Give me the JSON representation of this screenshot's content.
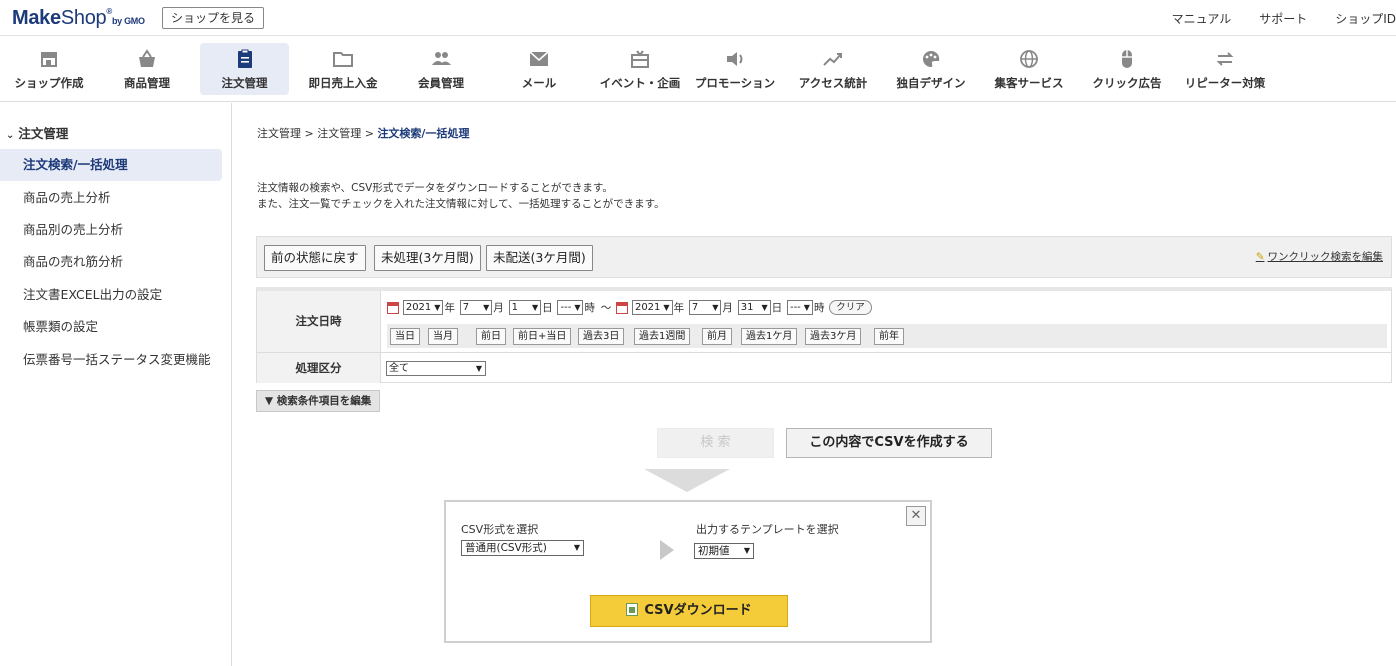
{
  "brand": {
    "name_bold": "Make",
    "name_rest": "Shop",
    "mark": "®",
    "by": "by GMO"
  },
  "header": {
    "shop_button": "ショップを見る",
    "links": [
      "マニュアル",
      "サポート",
      "ショップID"
    ]
  },
  "nav": [
    {
      "label": "ショップ作成",
      "icon": "shop-icon"
    },
    {
      "label": "商品管理",
      "icon": "basket-icon"
    },
    {
      "label": "注文管理",
      "icon": "clipboard-icon"
    },
    {
      "label": "即日売上入金",
      "icon": "folder-icon"
    },
    {
      "label": "会員管理",
      "icon": "users-icon"
    },
    {
      "label": "メール",
      "icon": "mail-icon"
    },
    {
      "label": "イベント・企画",
      "icon": "gift-icon"
    },
    {
      "label": "プロモーション",
      "icon": "speaker-icon"
    },
    {
      "label": "アクセス統計",
      "icon": "trend-icon"
    },
    {
      "label": "独自デザイン",
      "icon": "palette-icon"
    },
    {
      "label": "集客サービス",
      "icon": "globe-icon"
    },
    {
      "label": "クリック広告",
      "icon": "mouse-icon"
    },
    {
      "label": "リピーター対策",
      "icon": "repeat-icon"
    }
  ],
  "sidebar": {
    "heading": "注文管理",
    "items": [
      "注文検索/一括処理",
      "商品の売上分析",
      "商品別の売上分析",
      "商品の売れ筋分析",
      "注文書EXCEL出力の設定",
      "帳票類の設定",
      "伝票番号一括ステータス変更機能"
    ]
  },
  "breadcrumb": {
    "items": [
      "注文管理",
      "注文管理"
    ],
    "current": "注文検索/一括処理",
    "sep": ">"
  },
  "description": {
    "line1": "注文情報の検索や、CSV形式でデータをダウンロードすることができます。",
    "line2": "また、注文一覧でチェックを入れた注文情報に対して、一括処理することができます。"
  },
  "quick": {
    "buttons": [
      "前の状態に戻す",
      "未処理(3ケ月間)",
      "未配送(3ケ月間)"
    ],
    "edit_link": "ワンクリック検索を編集"
  },
  "form": {
    "order_date_label": "注文日時",
    "from": {
      "year": "2021",
      "month": "7",
      "day": "1",
      "hour": "---"
    },
    "to": {
      "year": "2021",
      "month": "7",
      "day": "31",
      "hour": "---"
    },
    "units": {
      "year": "年",
      "month": "月",
      "day": "日",
      "hour": "時"
    },
    "tilde": "〜",
    "clear": "クリア",
    "ranges": [
      "当日",
      "当月",
      "前日",
      "前日+当日",
      "過去3日",
      "過去1週間",
      "前月",
      "過去1ケ月",
      "過去3ケ月",
      "前年"
    ],
    "status_label": "処理区分",
    "status_value": "全て"
  },
  "edit_conditions": "▼ 検索条件項目を編集",
  "search_button": "検 索",
  "csv_make_button": "この内容でCSVを作成する",
  "csv_panel": {
    "format_label": "CSV形式を選択",
    "format_value": "普通用(CSV形式)",
    "template_label": "出力するテンプレートを選択",
    "template_value": "初期値",
    "download_button": "CSVダウンロード",
    "close": "✕"
  }
}
